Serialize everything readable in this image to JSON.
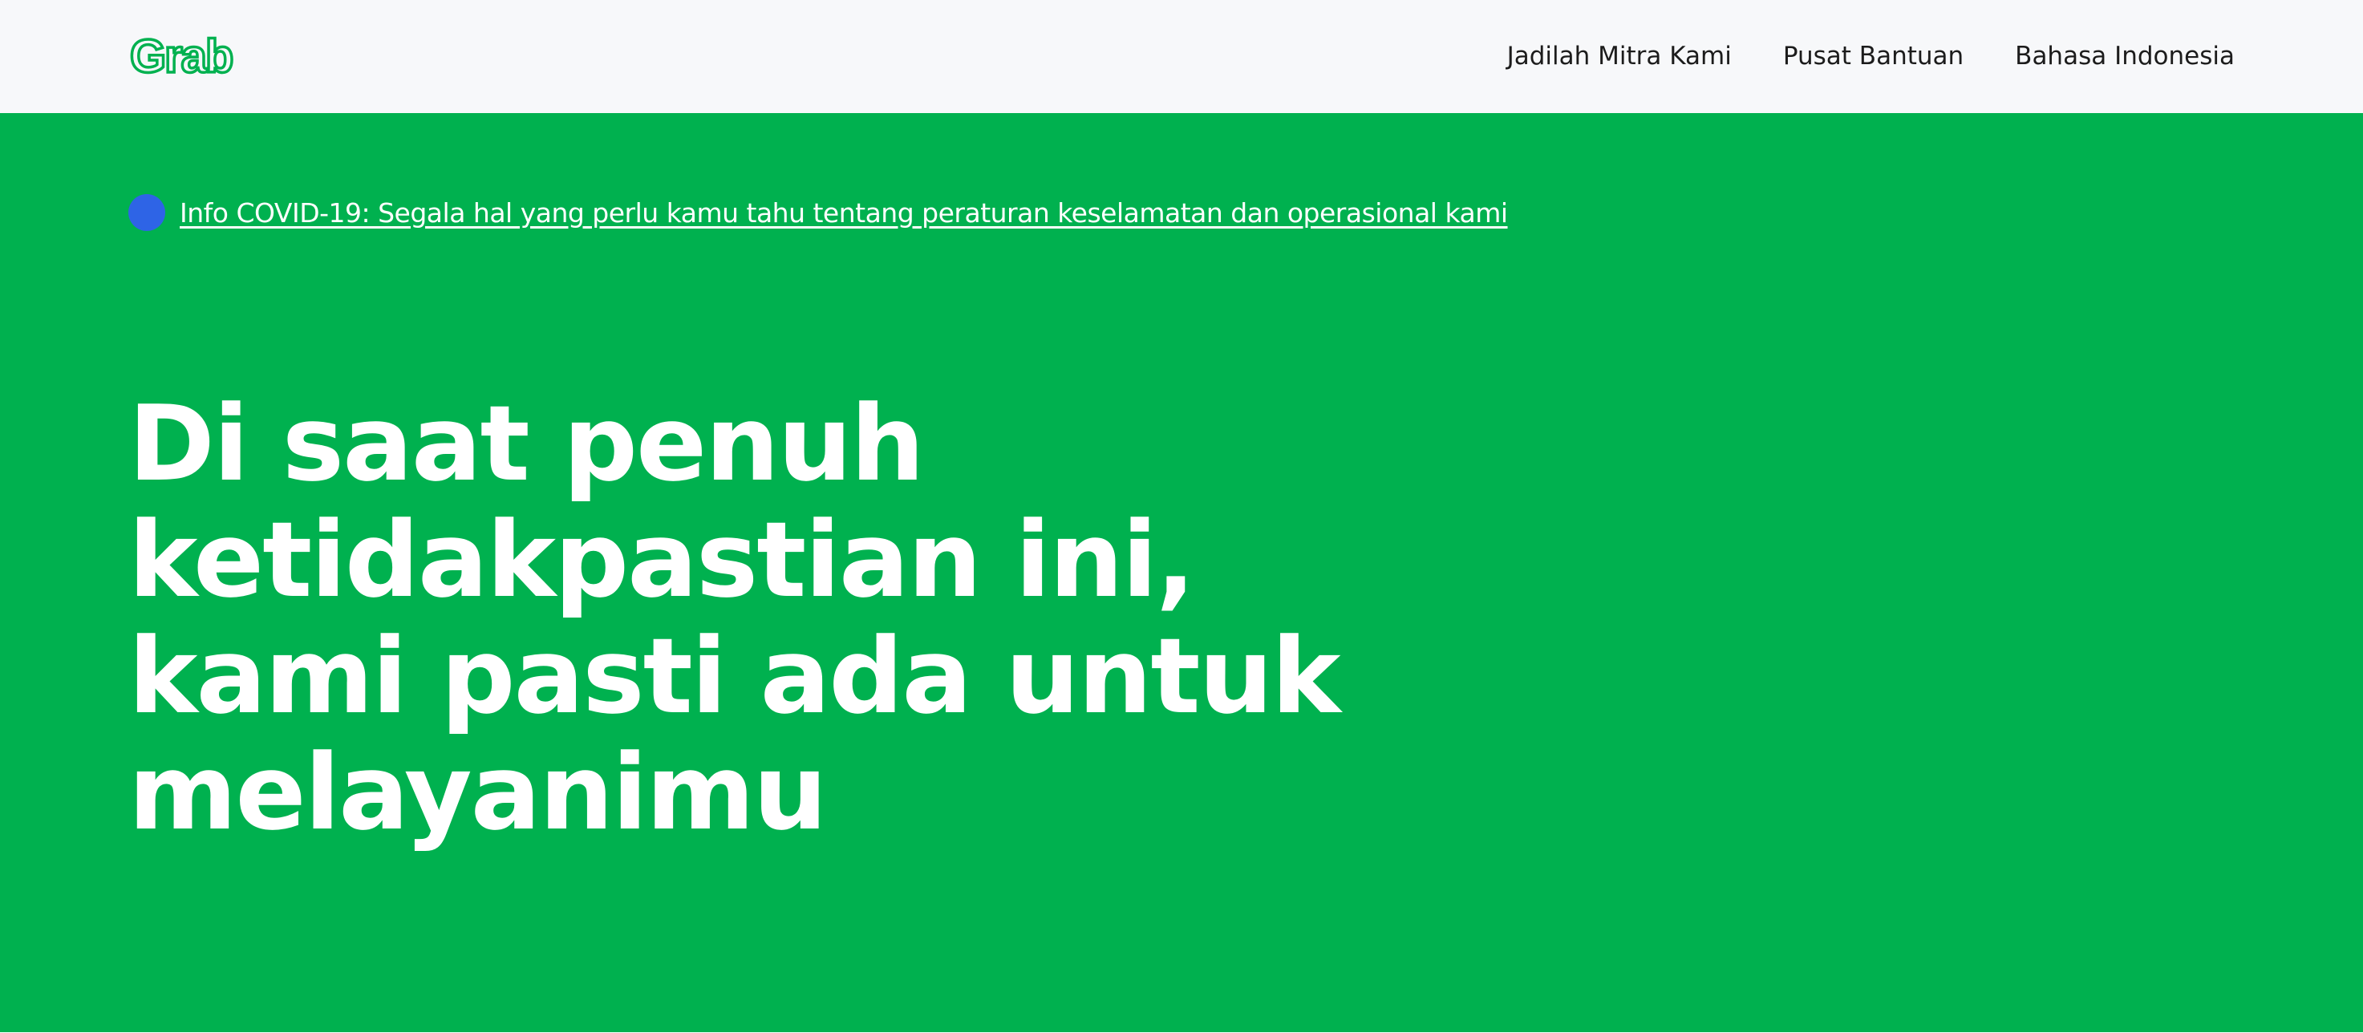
{
  "header": {
    "logo_text": "Grab",
    "nav": [
      {
        "label": "Jadilah Mitra Kami"
      },
      {
        "label": "Pusat Bantuan"
      },
      {
        "label": "Bahasa Indonesia"
      }
    ]
  },
  "hero": {
    "covid_link": "Info COVID-19: Segala hal yang perlu kamu tahu tentang peraturan keselamatan dan operasional kami",
    "headline": "Di saat penuh ketidakpastian ini, kami pasti ada untuk melayanimu"
  },
  "colors": {
    "brand_green": "#00b14f",
    "header_bg": "#f7f8fa",
    "covid_dot": "#2e64e6",
    "nav_text": "#1c1c1c"
  }
}
